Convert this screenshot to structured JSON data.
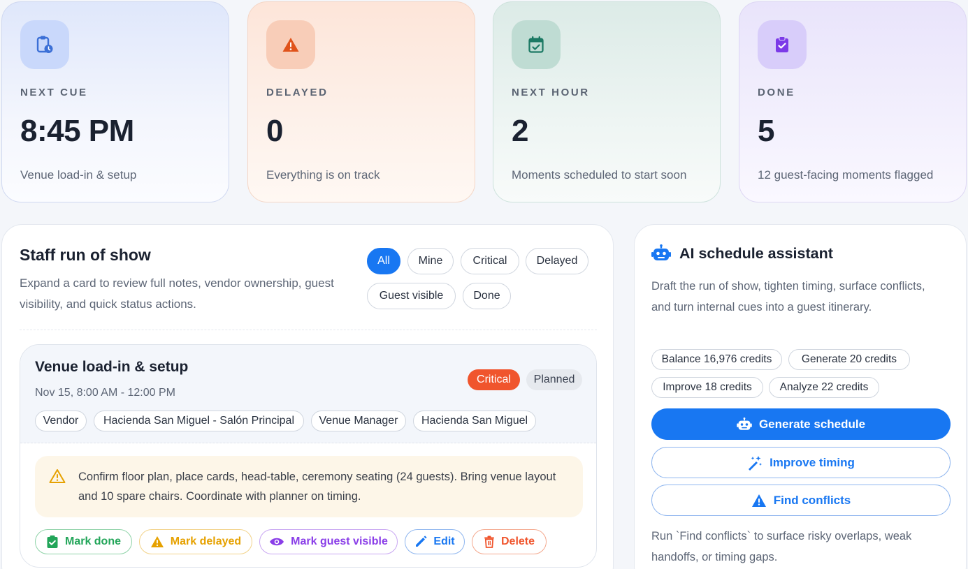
{
  "stats": [
    {
      "label": "NEXT CUE",
      "value": "8:45 PM",
      "sub": "Venue load-in & setup",
      "icon": "clipboard-clock-icon",
      "accent": "#3b6fd6"
    },
    {
      "label": "DELAYED",
      "value": "0",
      "sub": "Everything is on track",
      "icon": "warning-icon",
      "accent": "#e0521a"
    },
    {
      "label": "NEXT HOUR",
      "value": "2",
      "sub": "Moments scheduled to start soon",
      "icon": "calendar-check-icon",
      "accent": "#1c7a64"
    },
    {
      "label": "DONE",
      "value": "5",
      "sub": "12 guest-facing moments flagged",
      "icon": "clipboard-check-icon",
      "accent": "#7c3ae8"
    }
  ],
  "run_of_show": {
    "title": "Staff run of show",
    "description": "Expand a card to review full notes, vendor ownership, guest visibility, and quick status actions.",
    "filters": [
      "All",
      "Mine",
      "Critical",
      "Delayed",
      "Guest visible",
      "Done"
    ],
    "active_filter": "All",
    "card": {
      "title": "Venue load-in & setup",
      "date": "Nov 15, 8:00 AM - 12:00 PM",
      "priority_badge": "Critical",
      "status_badge": "Planned",
      "tags": [
        "Vendor",
        "Hacienda San Miguel - Salón Principal",
        "Venue Manager",
        "Hacienda San Miguel"
      ],
      "note": "Confirm floor plan, place cards, head-table, ceremony seating (24 guests). Bring venue layout and 10 spare chairs. Coordinate with planner on timing.",
      "actions": {
        "done": "Mark done",
        "delayed": "Mark delayed",
        "guest": "Mark guest visible",
        "edit": "Edit",
        "delete": "Delete"
      }
    }
  },
  "ai": {
    "title": "AI schedule assistant",
    "description": "Draft the run of show, tighten timing, surface conflicts, and turn internal cues into a guest itinerary.",
    "credits": {
      "balance": "Balance 16,976 credits",
      "generate": "Generate 20 credits",
      "improve": "Improve 18 credits",
      "analyze": "Analyze 22 credits"
    },
    "buttons": {
      "generate": "Generate schedule",
      "improve": "Improve timing",
      "conflicts": "Find conflicts"
    },
    "hint": "Run `Find conflicts` to surface risky overlaps, weak handoffs, or timing gaps."
  },
  "colors": {
    "primary": "#1877f2",
    "critical": "#f0552d",
    "success": "#22a559",
    "warning": "#e6a100",
    "purple": "#8a3ee8",
    "danger": "#f0552d"
  }
}
